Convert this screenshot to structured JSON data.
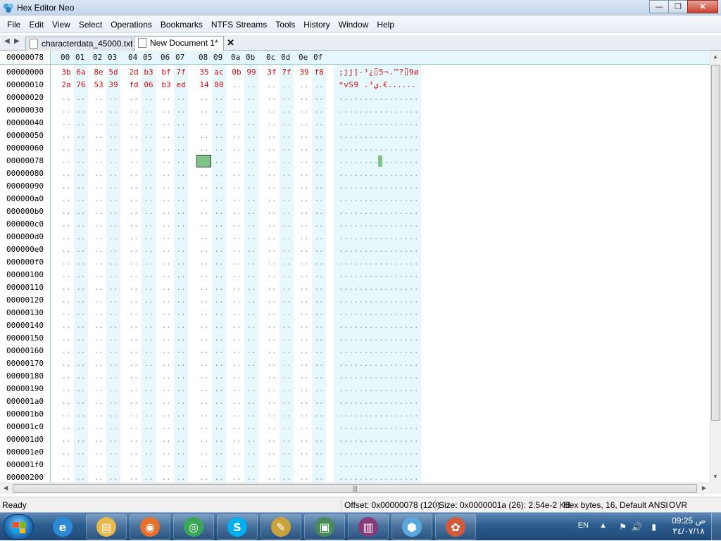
{
  "window": {
    "title": "Hex Editor Neo",
    "min_glyph": "—",
    "max_glyph": "❐",
    "close_glyph": "✕"
  },
  "menu": [
    "File",
    "Edit",
    "View",
    "Select",
    "Operations",
    "Bookmarks",
    "NTFS Streams",
    "Tools",
    "History",
    "Window",
    "Help"
  ],
  "tabs": [
    {
      "label": "characterdata_45000.txt",
      "active": false
    },
    {
      "label": "New Document 1*",
      "active": true
    }
  ],
  "tab_close_glyph": "✕",
  "nav_glyphs": {
    "left": "◀",
    "right": "▶"
  },
  "column_header": {
    "offset": "00000078",
    "columns": [
      "00",
      "01",
      "02",
      "03",
      "04",
      "05",
      "06",
      "07",
      "08",
      "09",
      "0a",
      "0b",
      "0c",
      "0d",
      "0e",
      "0f"
    ]
  },
  "rows": [
    {
      "offset": "00000000",
      "bytes": [
        "3b",
        "6a",
        "8e",
        "5d",
        "2d",
        "b3",
        "bf",
        "7f",
        "35",
        "ac",
        "0b",
        "99",
        "3f",
        "7f",
        "39",
        "f8"
      ],
      "text": ";jj]-³¿⌷5¬.™?⌷9ø"
    },
    {
      "offset": "00000010",
      "bytes": [
        "2a",
        "76",
        "53",
        "39",
        "fd",
        "06",
        "b3",
        "ed",
        "14",
        "80",
        "..",
        "..",
        "..",
        "..",
        "..",
        ".."
      ],
      "text": "*vS9 .³ي.€......"
    },
    {
      "offset": "00000020"
    },
    {
      "offset": "00000030"
    },
    {
      "offset": "00000040"
    },
    {
      "offset": "00000050"
    },
    {
      "offset": "00000060"
    },
    {
      "offset": "00000078"
    },
    {
      "offset": "00000080"
    },
    {
      "offset": "00000090"
    },
    {
      "offset": "000000a0"
    },
    {
      "offset": "000000b0"
    },
    {
      "offset": "000000c0"
    },
    {
      "offset": "000000d0"
    },
    {
      "offset": "000000e0"
    },
    {
      "offset": "000000f0"
    },
    {
      "offset": "00000100"
    },
    {
      "offset": "00000110"
    },
    {
      "offset": "00000120"
    },
    {
      "offset": "00000130"
    },
    {
      "offset": "00000140"
    },
    {
      "offset": "00000150"
    },
    {
      "offset": "00000160"
    },
    {
      "offset": "00000170"
    },
    {
      "offset": "00000180"
    },
    {
      "offset": "00000190"
    },
    {
      "offset": "000001a0"
    },
    {
      "offset": "000001b0"
    },
    {
      "offset": "000001c0"
    },
    {
      "offset": "000001d0"
    },
    {
      "offset": "000001e0"
    },
    {
      "offset": "000001f0"
    },
    {
      "offset": "00000200"
    }
  ],
  "empty_byte": "..",
  "empty_text": "................",
  "cursor_text": "..",
  "status": {
    "ready": "Ready",
    "offset": "Offset: 0x00000078 (120)",
    "size": "Size: 0x0000001a (26): 2.54e-2 KB",
    "mode": "Hex bytes, 16, Default ANSI",
    "ovr": "OVR"
  },
  "taskbar": {
    "apps": [
      {
        "name": "internet-explorer",
        "glyph": "e",
        "color": "#2a8ad8"
      },
      {
        "name": "explorer",
        "glyph": "▤",
        "color": "#e8b84a"
      },
      {
        "name": "firefox",
        "glyph": "◉",
        "color": "#e8702a"
      },
      {
        "name": "chrome",
        "glyph": "◎",
        "color": "#3aa757"
      },
      {
        "name": "skype",
        "glyph": "S",
        "color": "#00aff0"
      },
      {
        "name": "tools",
        "glyph": "✎",
        "color": "#c9a23a"
      },
      {
        "name": "monitor",
        "glyph": "▣",
        "color": "#4a8a5a"
      },
      {
        "name": "winrar",
        "glyph": "▥",
        "color": "#8a3a7a"
      },
      {
        "name": "hex-editor-neo",
        "glyph": "⬢",
        "color": "#5aa8e0"
      },
      {
        "name": "paint",
        "glyph": "✿",
        "color": "#d05a3a"
      }
    ],
    "lang": "EN",
    "tray_arrow": "▲",
    "tray_icons": [
      "⚑",
      "🔊",
      "▮"
    ],
    "time": "09:25 ص",
    "date": "٣٤/٠٧/١٨"
  },
  "hscroll_grip": "|||"
}
